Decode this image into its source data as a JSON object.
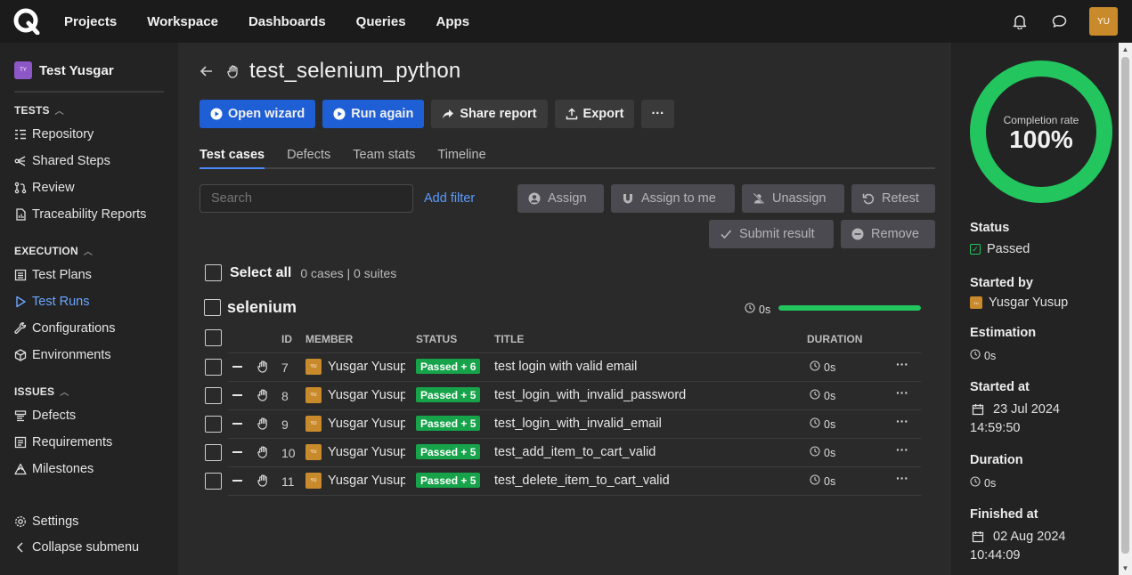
{
  "topnav": {
    "items": [
      "Projects",
      "Workspace",
      "Dashboards",
      "Queries",
      "Apps"
    ],
    "avatar": "YU"
  },
  "sidebar": {
    "workspace_badge": "TY",
    "workspace_name": "Test Yusgar",
    "tests_section": "TESTS",
    "tests_items": [
      "Repository",
      "Shared Steps",
      "Review",
      "Traceability Reports"
    ],
    "execution_section": "EXECUTION",
    "execution_items": [
      "Test Plans",
      "Test Runs",
      "Configurations",
      "Environments"
    ],
    "issues_section": "ISSUES",
    "issues_items": [
      "Defects",
      "Requirements",
      "Milestones"
    ],
    "settings": "Settings",
    "collapse": "Collapse submenu"
  },
  "main": {
    "title": "test_selenium_python",
    "buttons": {
      "open_wizard": "Open wizard",
      "run_again": "Run again",
      "share_report": "Share report",
      "export": "Export",
      "more": "···"
    },
    "tabs": [
      "Test cases",
      "Defects",
      "Team stats",
      "Timeline"
    ],
    "search_placeholder": "Search",
    "add_filter": "Add filter",
    "actions": {
      "assign": "Assign",
      "assign_to_me": "Assign to me",
      "unassign": "Unassign",
      "retest": "Retest",
      "submit_result": "Submit result",
      "remove": "Remove"
    },
    "select_all": "Select all",
    "select_meta": "0 cases | 0 suites",
    "suite": {
      "name": "selenium",
      "duration": "0s",
      "progress": 1.0
    },
    "columns": {
      "id": "ID",
      "member": "MEMBER",
      "status": "STATUS",
      "title": "TITLE",
      "duration": "DURATION"
    },
    "rows": [
      {
        "id": "7",
        "avatar": "YU",
        "member": "Yusgar Yusup",
        "status": "Passed + 6",
        "title": "test login with valid email",
        "duration": "0s"
      },
      {
        "id": "8",
        "avatar": "YU",
        "member": "Yusgar Yusup",
        "status": "Passed + 5",
        "title": "test_login_with_invalid_password",
        "duration": "0s"
      },
      {
        "id": "9",
        "avatar": "YU",
        "member": "Yusgar Yusup",
        "status": "Passed + 5",
        "title": "test_login_with_invalid_email",
        "duration": "0s"
      },
      {
        "id": "10",
        "avatar": "YU",
        "member": "Yusgar Yusup",
        "status": "Passed + 5",
        "title": "test_add_item_to_cart_valid",
        "duration": "0s"
      },
      {
        "id": "11",
        "avatar": "YU",
        "member": "Yusgar Yusup",
        "status": "Passed + 5",
        "title": "test_delete_item_to_cart_valid",
        "duration": "0s"
      }
    ]
  },
  "right_panel": {
    "completion_label": "Completion rate",
    "completion_value": "100%",
    "completion_fraction": 1.0,
    "status_label": "Status",
    "status_value": "Passed",
    "started_by_label": "Started by",
    "started_by_avatar": "YU",
    "started_by_value": "Yusgar Yusup",
    "estimation_label": "Estimation",
    "estimation_value": "0s",
    "started_at_label": "Started at",
    "started_at_date": "23 Jul 2024",
    "started_at_time": "14:59:50",
    "duration_label": "Duration",
    "duration_value": "0s",
    "finished_at_label": "Finished at",
    "finished_at_date": "02 Aug 2024",
    "finished_at_time": "10:44:09"
  },
  "colors": {
    "accent_blue": "#1f5fd6",
    "link_blue": "#5b9bff",
    "passed_green": "#16a34a",
    "progress_green": "#22c55e",
    "avatar_orange": "#c98a2b",
    "workspace_purple": "#8e57c7"
  },
  "icons": {
    "logo": "q-logo",
    "notifications": "bell-icon",
    "chat": "chat-bubble-icon",
    "back": "arrow-left-icon",
    "manual": "hand-icon",
    "clock": "clock-icon",
    "calendar": "calendar-icon"
  }
}
